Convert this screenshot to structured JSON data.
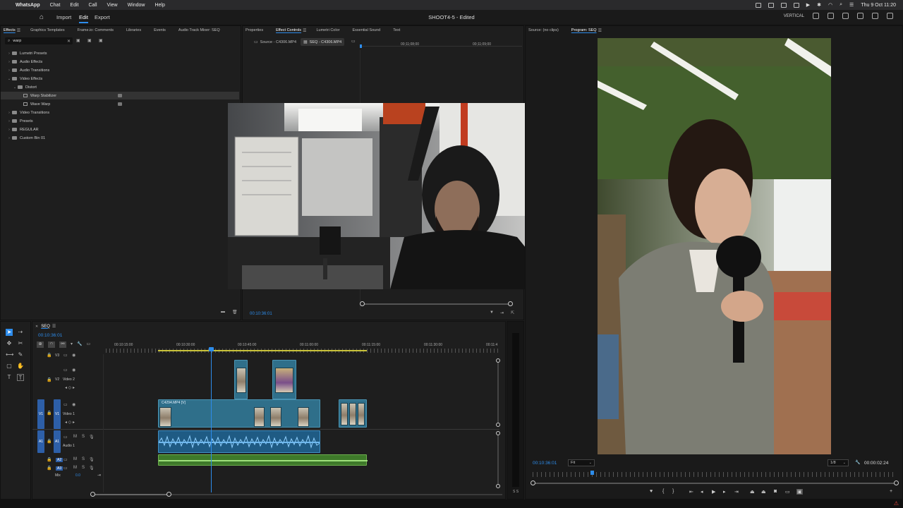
{
  "menubar": {
    "app": "WhatsApp",
    "items": [
      "Chat",
      "Edit",
      "Call",
      "View",
      "Window",
      "Help"
    ],
    "clock": "Thu 9 Oct 11:20"
  },
  "header": {
    "workspaces": [
      "Import",
      "Edit",
      "Export"
    ],
    "active_workspace": "Edit",
    "project_title": "SHOOT4-5 - Edited",
    "right_label": "VERTICAL"
  },
  "effects_panel": {
    "tabs": [
      "Effects",
      "Graphics Templates",
      "Frame.io: Comments",
      "Libraries",
      "Events",
      "Audio Track Mixer: SEQ"
    ],
    "active_tab": "Effects",
    "search_value": "warp",
    "tree": [
      {
        "label": "Lumetri Presets",
        "depth": 0,
        "kind": "folder",
        "open": false
      },
      {
        "label": "Audio Effects",
        "depth": 0,
        "kind": "folder",
        "open": false
      },
      {
        "label": "Audio Transitions",
        "depth": 0,
        "kind": "folder",
        "open": false
      },
      {
        "label": "Video Effects",
        "depth": 0,
        "kind": "folder",
        "open": true
      },
      {
        "label": "Distort",
        "depth": 1,
        "kind": "folder",
        "open": true
      },
      {
        "label": "Warp Stabilizer",
        "depth": 2,
        "kind": "effect",
        "selected": true
      },
      {
        "label": "Wave Warp",
        "depth": 2,
        "kind": "effect"
      },
      {
        "label": "Video Transitions",
        "depth": 0,
        "kind": "folder",
        "open": false
      },
      {
        "label": "Presets",
        "depth": 0,
        "kind": "folder",
        "open": false
      },
      {
        "label": "REGULAR",
        "depth": 0,
        "kind": "folder",
        "open": false
      },
      {
        "label": "Custom Bin 01",
        "depth": 0,
        "kind": "folder",
        "open": false
      }
    ]
  },
  "effect_controls": {
    "tabs": [
      "Properties",
      "Effect Controls",
      "Lumetri Color",
      "Essential Sound",
      "Text"
    ],
    "active_tab": "Effect Controls",
    "source_label": "Source - C4306.MP4",
    "seq_label": "SEQ - C4306.MP4",
    "ruler": [
      "00;11;08;00",
      "00;11;09;00"
    ],
    "timecode": "00:10:36:01"
  },
  "program_monitor": {
    "tabs": [
      "Source: (no clips)",
      "Program: SEQ"
    ],
    "active_tab": "Program: SEQ",
    "timecode": "00:10:36:01",
    "zoom": "Fit",
    "resolution": "1/8",
    "duration": "00:00:02:24"
  },
  "timeline": {
    "sequence_name": "SEQ",
    "timecode": "00:10:36:01",
    "ruler": [
      "00:10:15:00",
      "00:10:30:00",
      "00:10:45:00",
      "00:11:00:00",
      "00:11:15:00",
      "00:11:30:00",
      "00:11:4"
    ],
    "tracks": {
      "v3": "V3",
      "v2": "V2",
      "v2_name": "Video 2",
      "v1": "V1",
      "v1_name": "Video 1",
      "a1": "A1",
      "a1_name": "Audio 1",
      "a2": "A2",
      "a3": "A3",
      "mix": "Mix",
      "mix_value": "0.0"
    },
    "clip_label": "C4294.MP4 [V]"
  }
}
